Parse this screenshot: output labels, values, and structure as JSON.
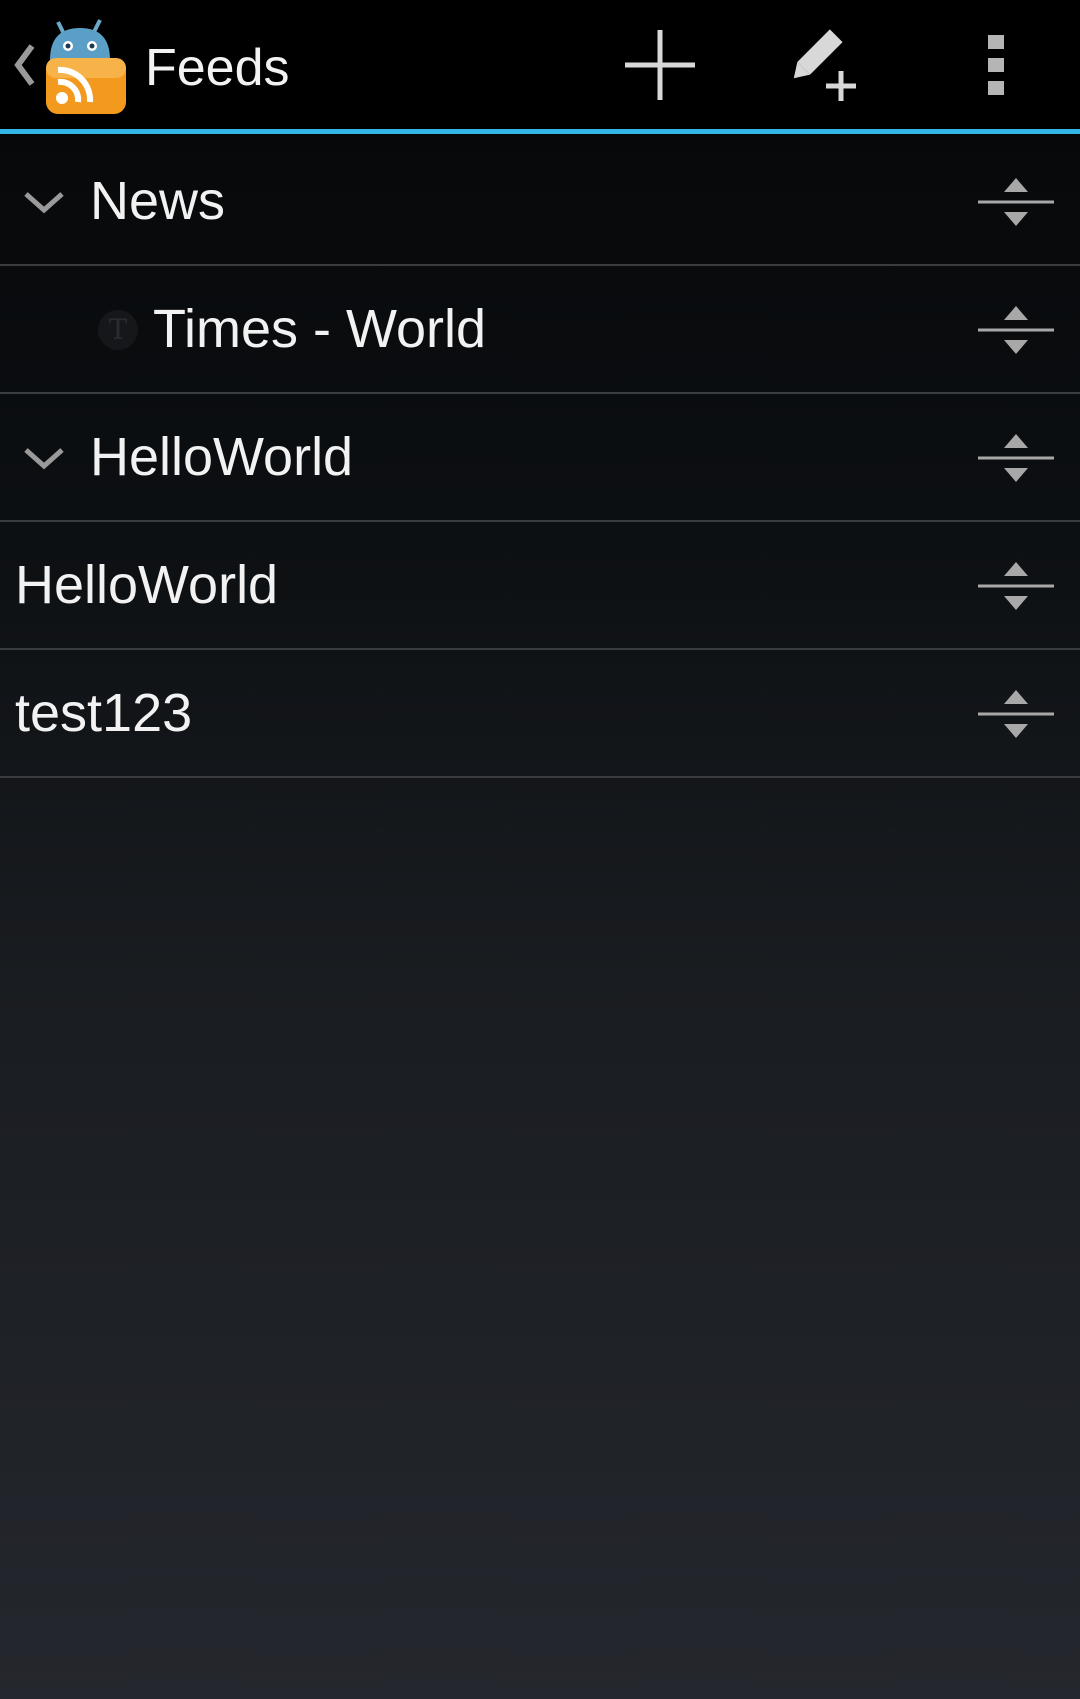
{
  "action_bar": {
    "title": "Feeds",
    "accent_color": "#33b5e5",
    "actions": [
      {
        "icon": "add-icon"
      },
      {
        "icon": "add-folder-icon"
      },
      {
        "icon": "overflow-menu-icon"
      }
    ]
  },
  "feed_list": {
    "items": [
      {
        "type": "group",
        "label": "News",
        "expanded": true
      },
      {
        "type": "feed",
        "label": "Times - World",
        "icon": "nyt-feed-icon"
      },
      {
        "type": "group",
        "label": "HelloWorld",
        "expanded": true
      },
      {
        "type": "feed",
        "label": "HelloWorld"
      },
      {
        "type": "feed",
        "label": "test123"
      }
    ]
  }
}
